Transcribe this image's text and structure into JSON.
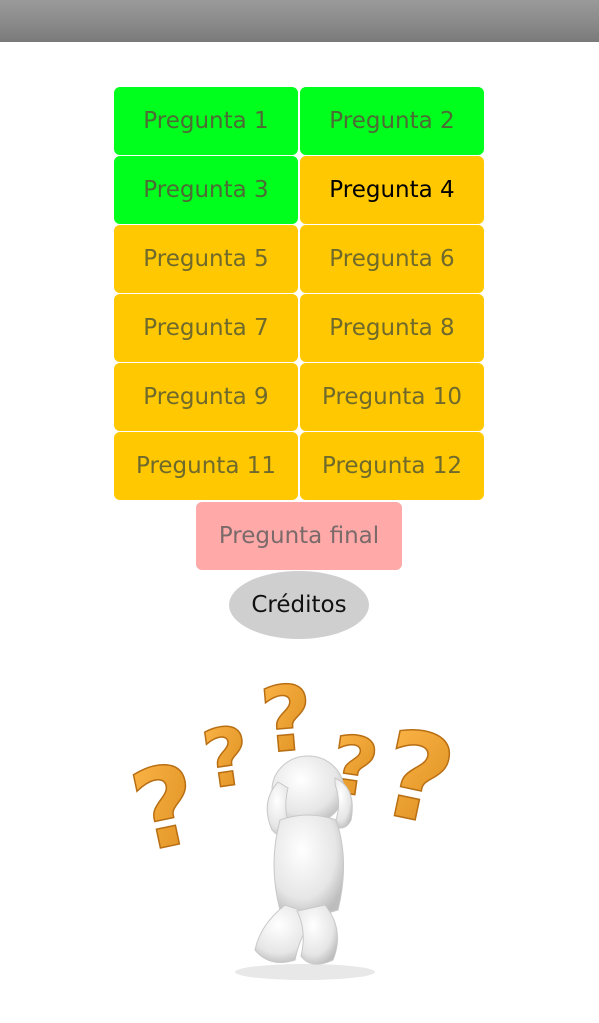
{
  "questions": [
    {
      "label": "Pregunta 1",
      "state": "done"
    },
    {
      "label": "Pregunta 2",
      "state": "done"
    },
    {
      "label": "Pregunta 3",
      "state": "done"
    },
    {
      "label": "Pregunta 4",
      "state": "active"
    },
    {
      "label": "Pregunta 5",
      "state": "pending"
    },
    {
      "label": "Pregunta 6",
      "state": "pending"
    },
    {
      "label": "Pregunta 7",
      "state": "pending"
    },
    {
      "label": "Pregunta 8",
      "state": "pending"
    },
    {
      "label": "Pregunta 9",
      "state": "pending"
    },
    {
      "label": "Pregunta 10",
      "state": "pending"
    },
    {
      "label": "Pregunta 11",
      "state": "pending"
    },
    {
      "label": "Pregunta 12",
      "state": "pending"
    }
  ],
  "final_label": "Pregunta final",
  "credits_label": "Créditos",
  "colors": {
    "done": "#00ff1d",
    "pending": "#ffc800",
    "final": "#ffaaa9",
    "credits": "#cfcfcf",
    "question_mark": "#f0a030"
  },
  "illustration_icon": "thinking-person-with-question-marks-illustration"
}
